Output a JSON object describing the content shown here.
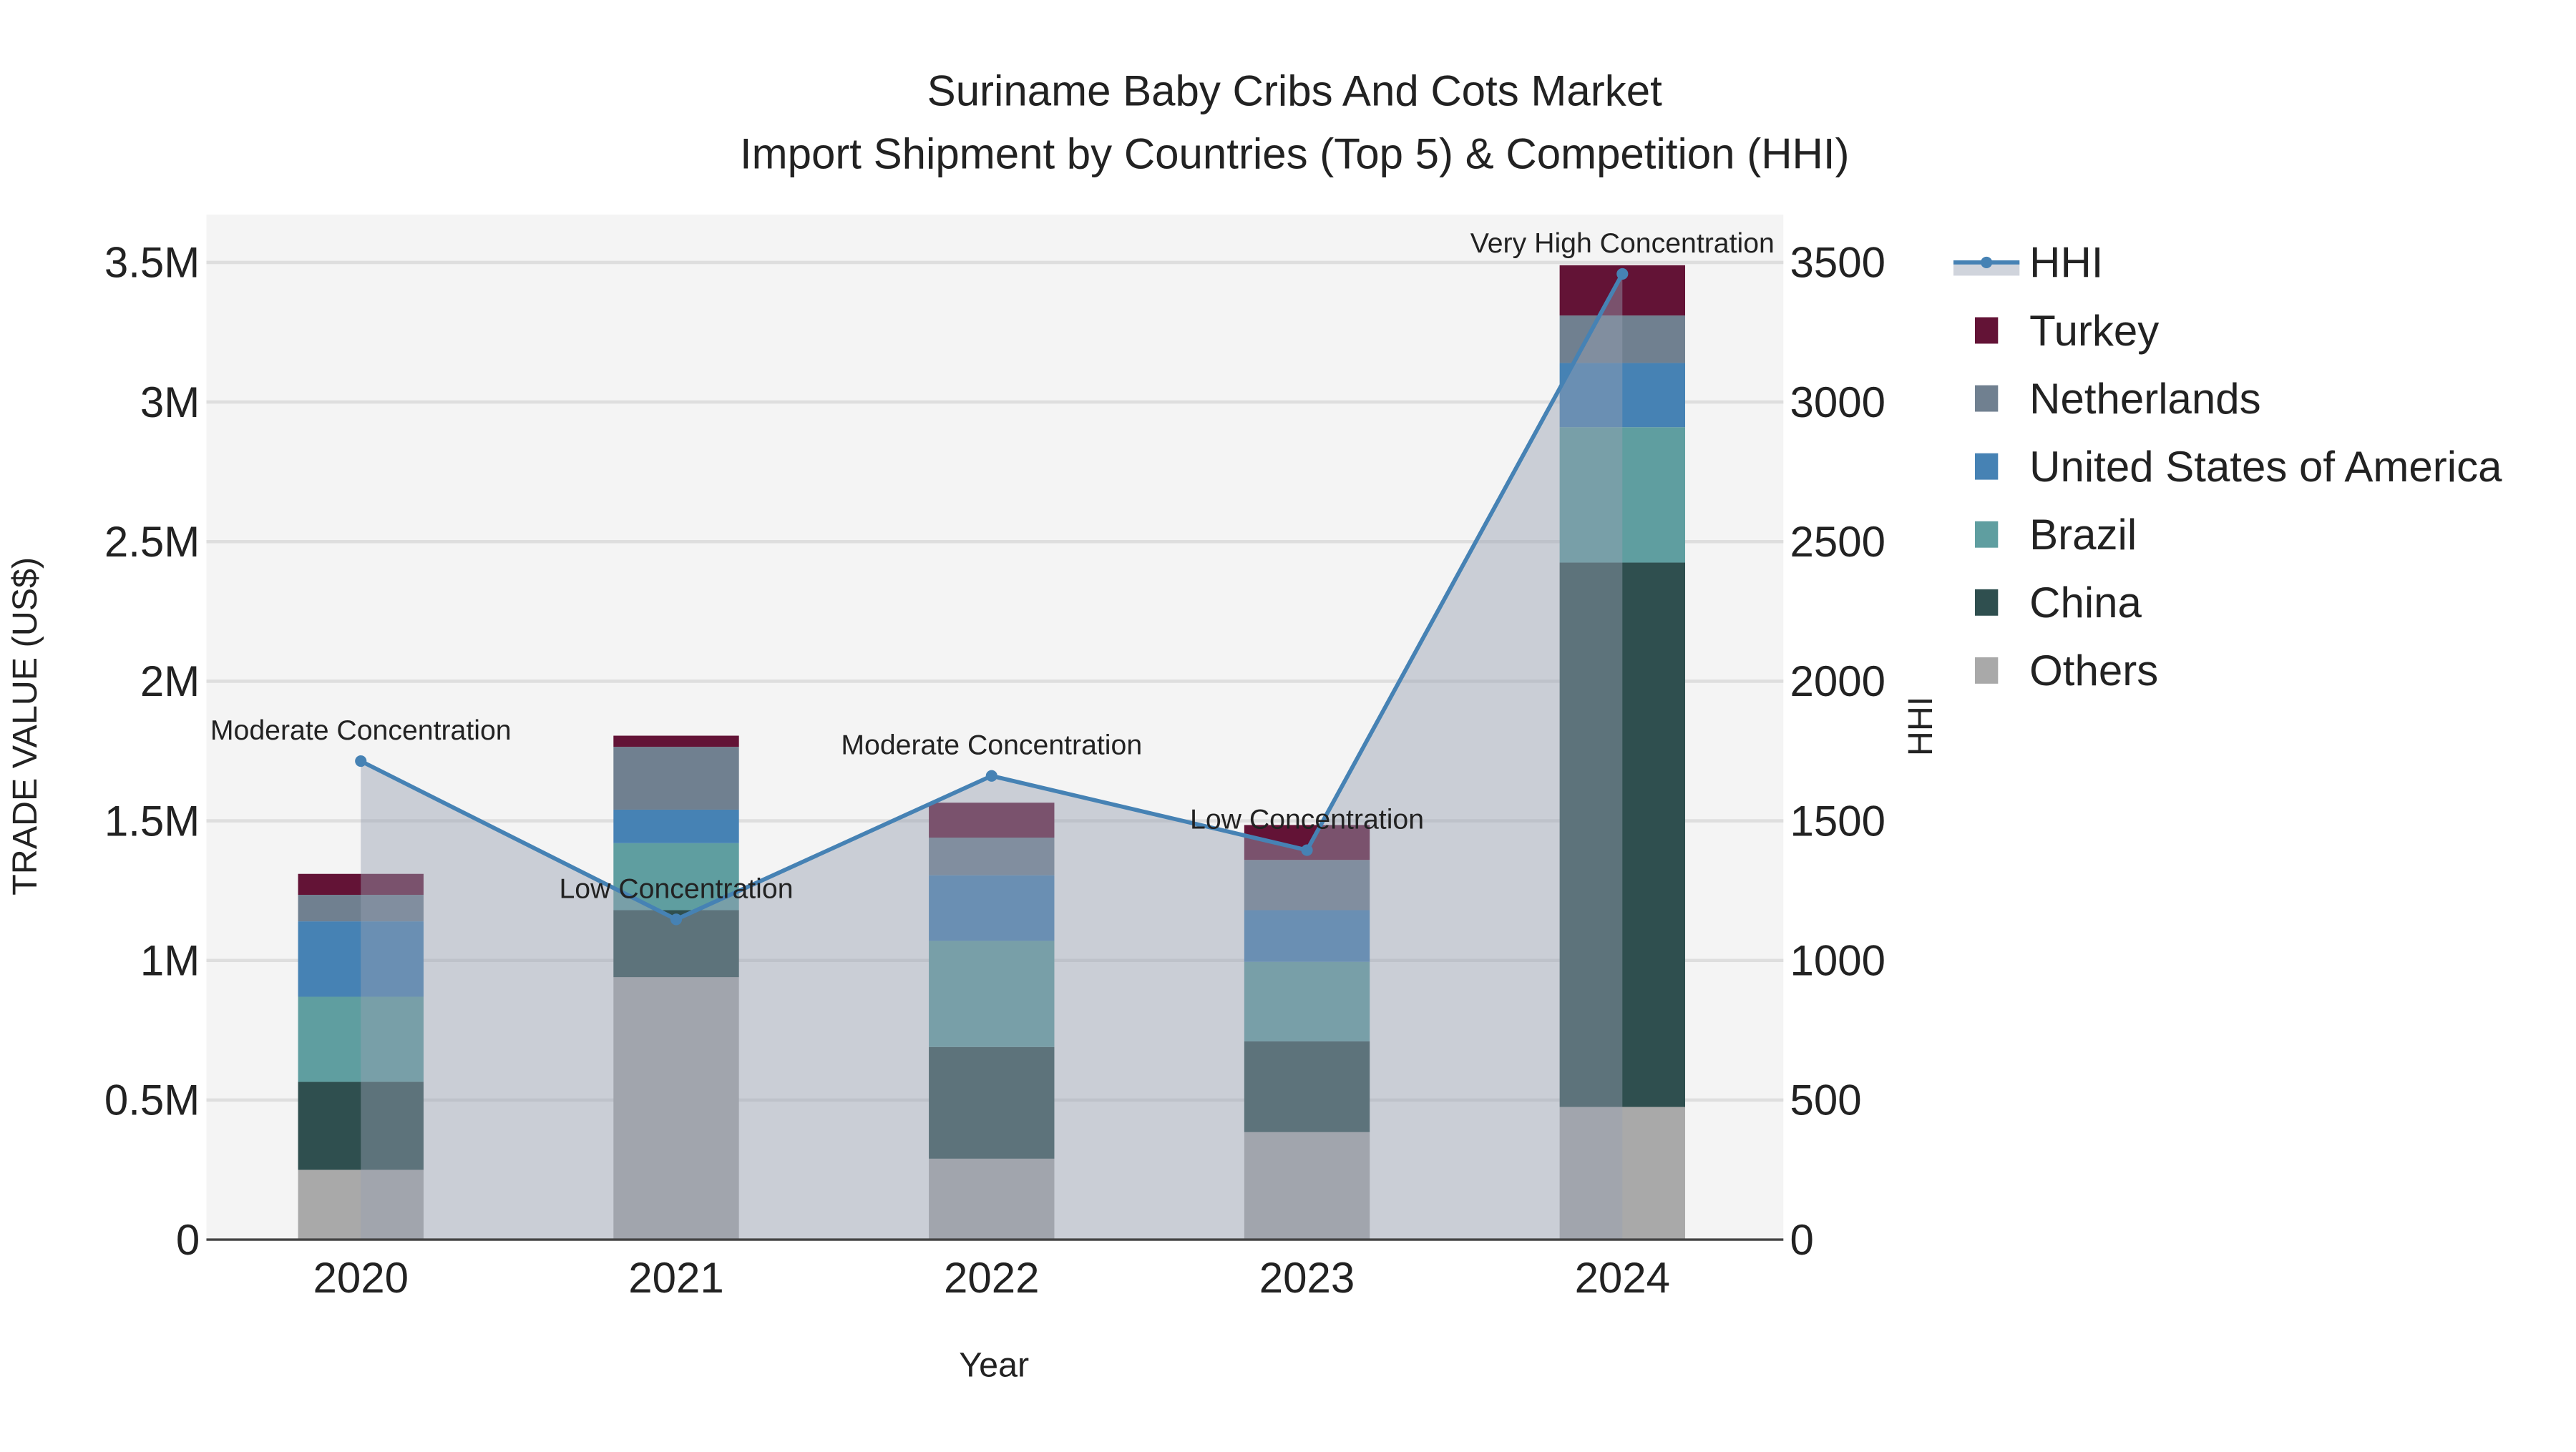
{
  "chart_data": {
    "type": "bar",
    "stacked": true,
    "title": "Suriname Baby Cribs And Cots Market",
    "subtitle": "Import Shipment by Countries (Top 5) & Competition (HHI)",
    "xlabel": "Year",
    "ylabel": "TRADE VALUE (US$)",
    "y2label": "HHI",
    "categories": [
      "2020",
      "2021",
      "2022",
      "2023",
      "2024"
    ],
    "ylim": [
      0,
      3650000
    ],
    "y2lim": [
      0,
      3650
    ],
    "yticks": [
      {
        "value": 0,
        "label": "0"
      },
      {
        "value": 500000,
        "label": "0.5M"
      },
      {
        "value": 1000000,
        "label": "1M"
      },
      {
        "value": 1500000,
        "label": "1.5M"
      },
      {
        "value": 2000000,
        "label": "2M"
      },
      {
        "value": 2500000,
        "label": "2.5M"
      },
      {
        "value": 3000000,
        "label": "3M"
      },
      {
        "value": 3500000,
        "label": "3.5M"
      }
    ],
    "y2ticks": [
      {
        "value": 0,
        "label": "0"
      },
      {
        "value": 500,
        "label": "500"
      },
      {
        "value": 1000,
        "label": "1000"
      },
      {
        "value": 1500,
        "label": "1500"
      },
      {
        "value": 2000,
        "label": "2000"
      },
      {
        "value": 2500,
        "label": "2500"
      },
      {
        "value": 3000,
        "label": "3000"
      },
      {
        "value": 3500,
        "label": "3500"
      }
    ],
    "series": [
      {
        "name": "Others",
        "color": "#A9A9A9",
        "values": [
          250000,
          940000,
          290000,
          385000,
          475000
        ]
      },
      {
        "name": "China",
        "color": "#2F4F4F",
        "values": [
          315000,
          240000,
          400000,
          325000,
          1950000
        ]
      },
      {
        "name": "Brazil",
        "color": "#5F9EA0",
        "values": [
          305000,
          240000,
          380000,
          285000,
          485000
        ]
      },
      {
        "name": "United States of America",
        "color": "#4682B4",
        "values": [
          270000,
          120000,
          235000,
          185000,
          230000
        ]
      },
      {
        "name": "Netherlands",
        "color": "#708090",
        "values": [
          95000,
          225000,
          135000,
          180000,
          170000
        ]
      },
      {
        "name": "Turkey",
        "color": "#631336",
        "values": [
          75000,
          40000,
          125000,
          125000,
          180000
        ]
      }
    ],
    "hhi": {
      "name": "HHI",
      "color": "#4682B4",
      "values": [
        1714,
        1147,
        1661,
        1395,
        3459
      ],
      "annotations": [
        "Moderate Concentration",
        "Low Concentration",
        "Moderate Concentration",
        "Low Concentration",
        "Very High Concentration"
      ]
    },
    "legend_order": [
      "HHI",
      "Turkey",
      "Netherlands",
      "United States of America",
      "Brazil",
      "China",
      "Others"
    ],
    "legend_placement": "right",
    "grid": true
  }
}
